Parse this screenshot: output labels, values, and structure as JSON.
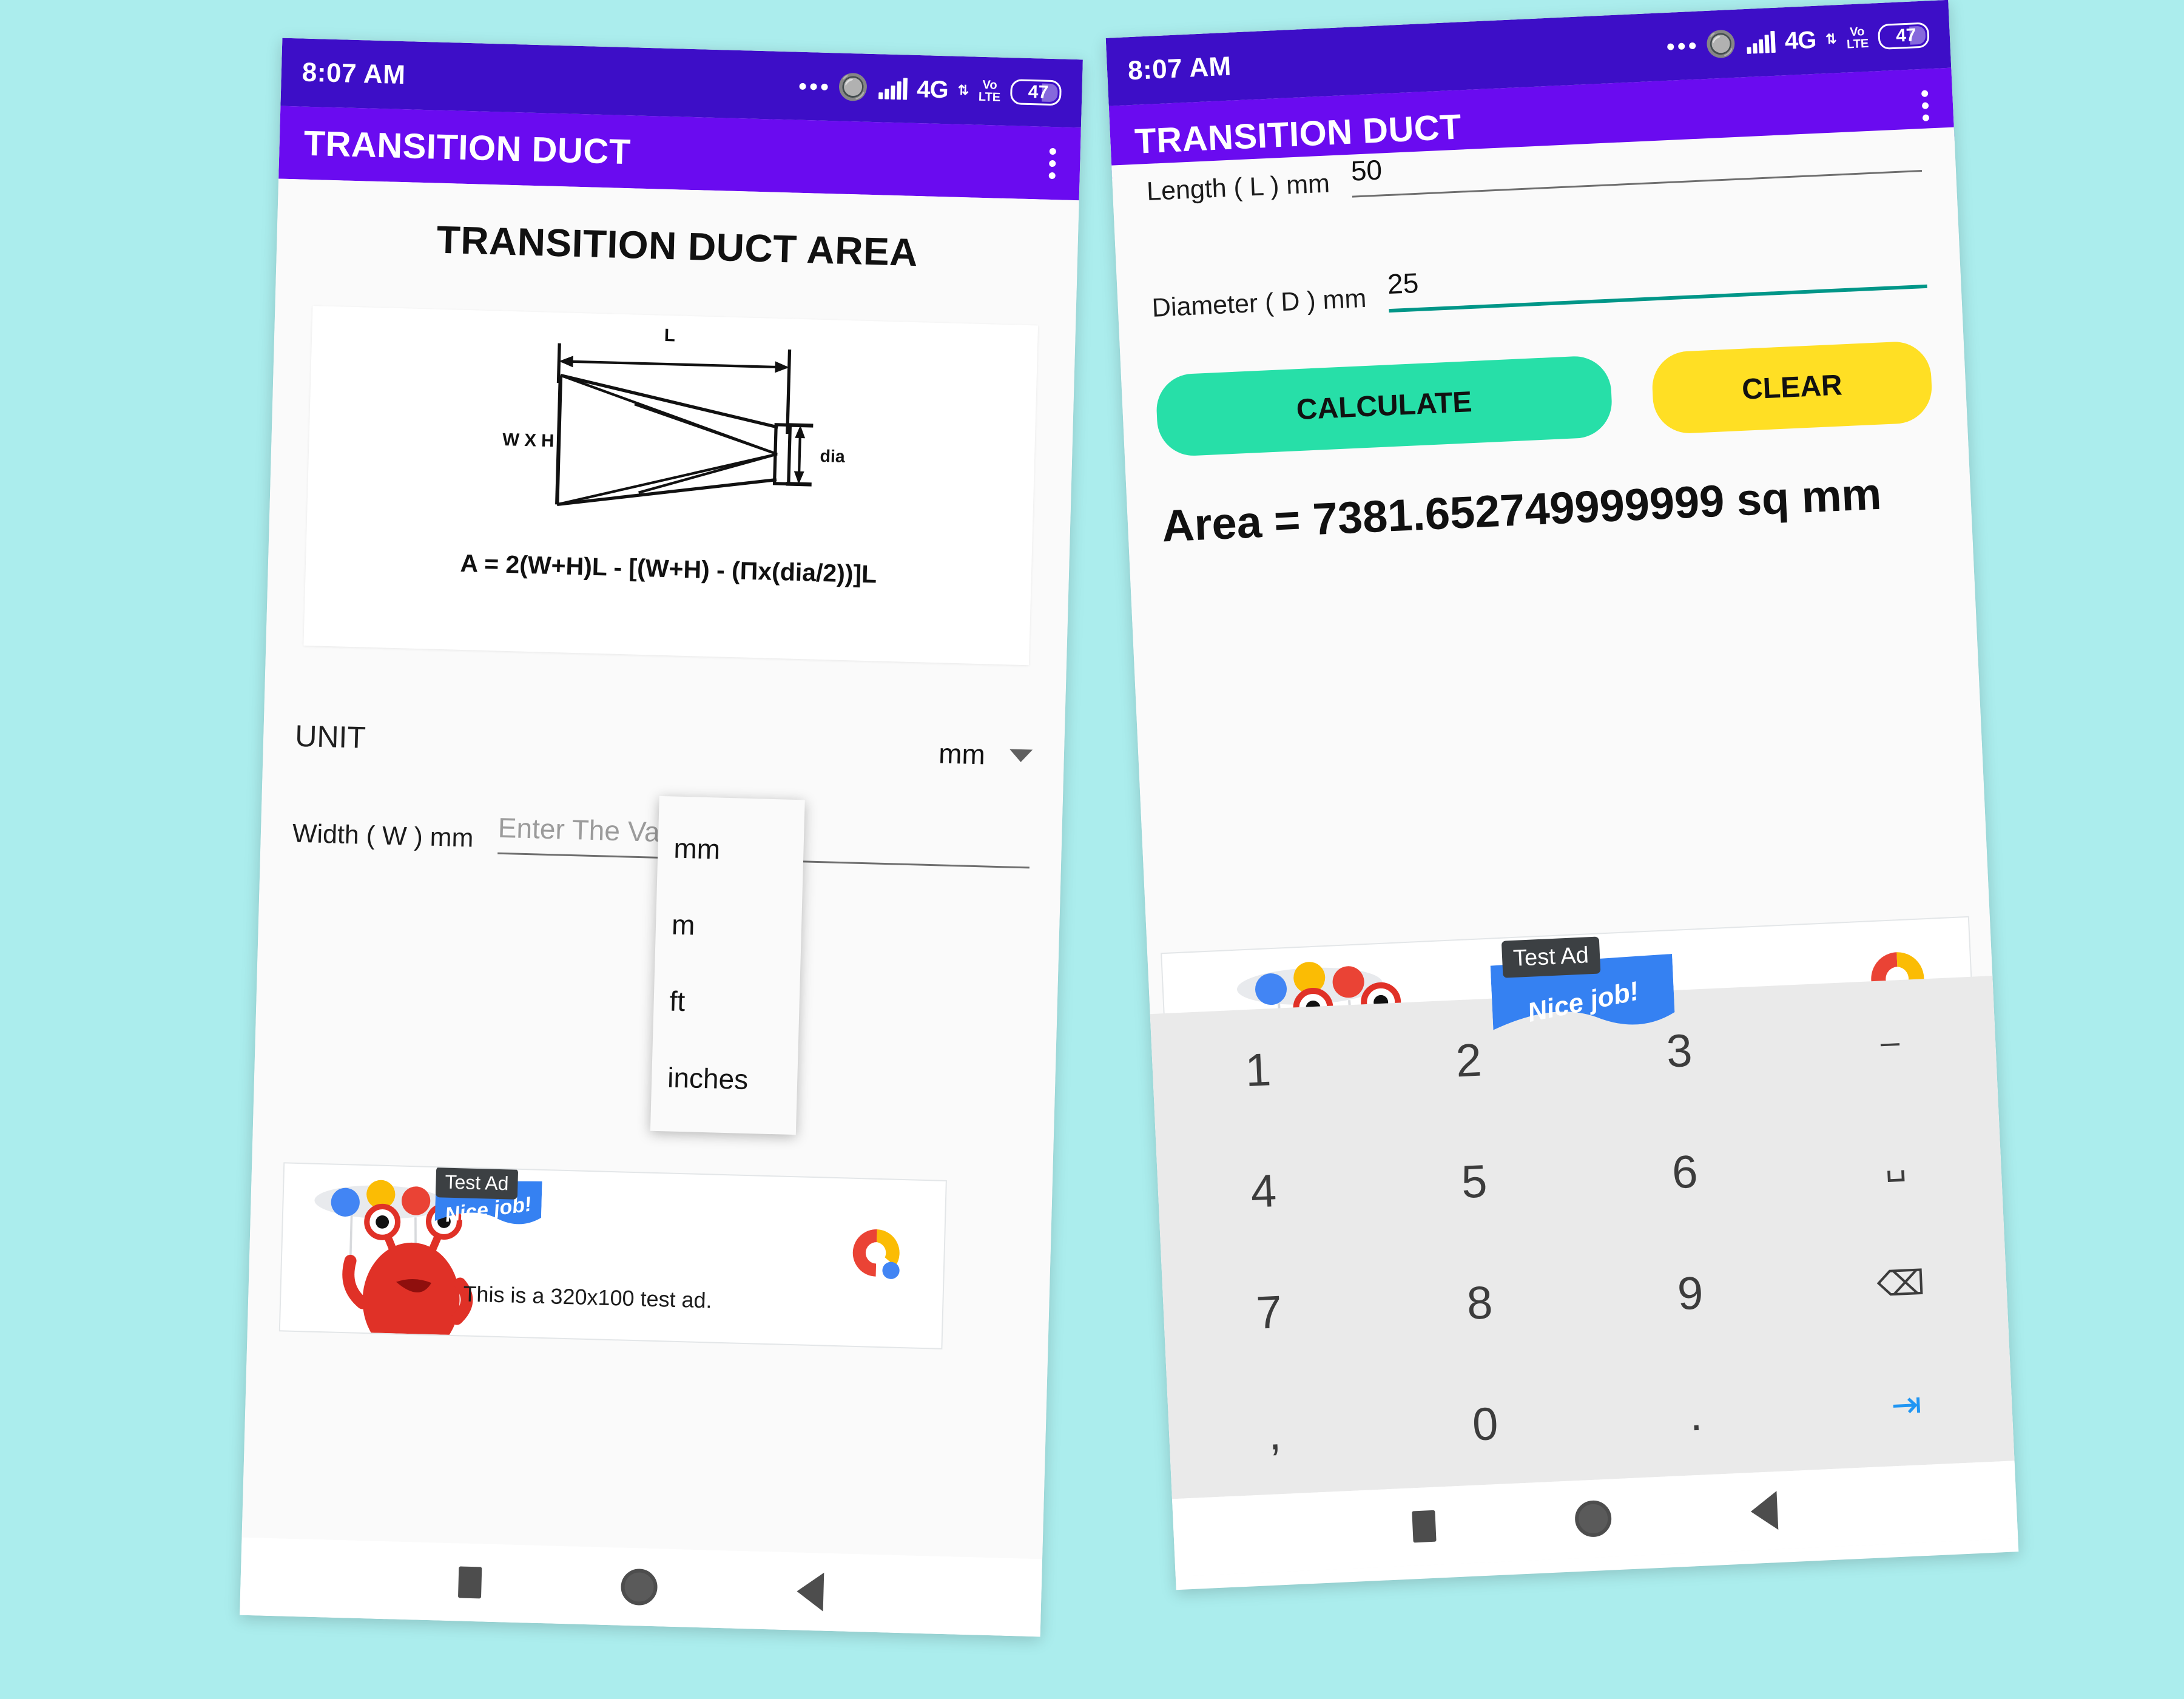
{
  "background_color": "#abeded",
  "theme": {
    "appbar_purple": "#6a0bf0",
    "statusbar_purple": "#3d0ec7",
    "calculate_green": "#27dfa8",
    "clear_yellow": "#ffdf24",
    "focus_teal": "#009688"
  },
  "status_bar": {
    "time": "8:07 AM",
    "network": "4G",
    "volte_top": "Vo",
    "volte_bottom": "LTE",
    "battery": "47",
    "icons": [
      "more-dots-icon",
      "bluetooth-icon",
      "signal-bars-icon",
      "network-4g-icon",
      "data-arrows-icon",
      "volte-icon",
      "battery-icon"
    ]
  },
  "app_bar": {
    "title": "TRANSITION DUCT",
    "overflow_icon": "kebab-menu-icon"
  },
  "left_screen": {
    "page_title": "TRANSITION DUCT AREA",
    "diagram": {
      "label_length": "L",
      "label_section": "W X H",
      "label_dia": "dia",
      "formula": "A = 2(W+H)L - [(W+H) - (Πx(dia/2))]L"
    },
    "unit": {
      "label": "UNIT",
      "selected": "mm",
      "caret_icon": "chevron-down-icon",
      "options": [
        "mm",
        "m",
        "ft",
        "inches"
      ]
    },
    "width_field": {
      "label": "Width ( W ) mm",
      "placeholder": "Enter The Value",
      "value": ""
    }
  },
  "right_screen": {
    "length_field": {
      "label": "Length ( L ) mm",
      "value": "50"
    },
    "diameter_field": {
      "label": "Diameter ( D ) mm",
      "value": "25"
    },
    "buttons": {
      "calculate": "CALCULATE",
      "clear": "CLEAR"
    },
    "result": "Area = 7381.652749999999 sq mm"
  },
  "ad": {
    "badge": "Test Ad",
    "flag_text": "Nice job!",
    "caption": "This is a 320x100 test ad.",
    "brand_icon": "admob-logo-icon",
    "mascot_icon": "red-monster-icon"
  },
  "keypad": {
    "keys": [
      {
        "label": "1",
        "name": "key-1",
        "kind": "digit"
      },
      {
        "label": "2",
        "name": "key-2",
        "kind": "digit"
      },
      {
        "label": "3",
        "name": "key-3",
        "kind": "digit"
      },
      {
        "label": "–",
        "name": "key-minus",
        "kind": "symbol"
      },
      {
        "label": "4",
        "name": "key-4",
        "kind": "digit"
      },
      {
        "label": "5",
        "name": "key-5",
        "kind": "digit"
      },
      {
        "label": "6",
        "name": "key-6",
        "kind": "digit"
      },
      {
        "label": "␣",
        "name": "key-space",
        "kind": "symbol"
      },
      {
        "label": "7",
        "name": "key-7",
        "kind": "digit"
      },
      {
        "label": "8",
        "name": "key-8",
        "kind": "digit"
      },
      {
        "label": "9",
        "name": "key-9",
        "kind": "digit"
      },
      {
        "label": "⌫",
        "name": "key-backspace",
        "kind": "symbol"
      },
      {
        "label": ",",
        "name": "key-comma",
        "kind": "digit"
      },
      {
        "label": "0",
        "name": "key-0",
        "kind": "digit"
      },
      {
        "label": ".",
        "name": "key-period",
        "kind": "digit"
      },
      {
        "label": "⇥",
        "name": "key-next",
        "kind": "blue"
      }
    ]
  },
  "nav_bar": {
    "recents_icon": "recents-square-icon",
    "home_icon": "home-circle-icon",
    "back_icon": "back-triangle-icon"
  }
}
